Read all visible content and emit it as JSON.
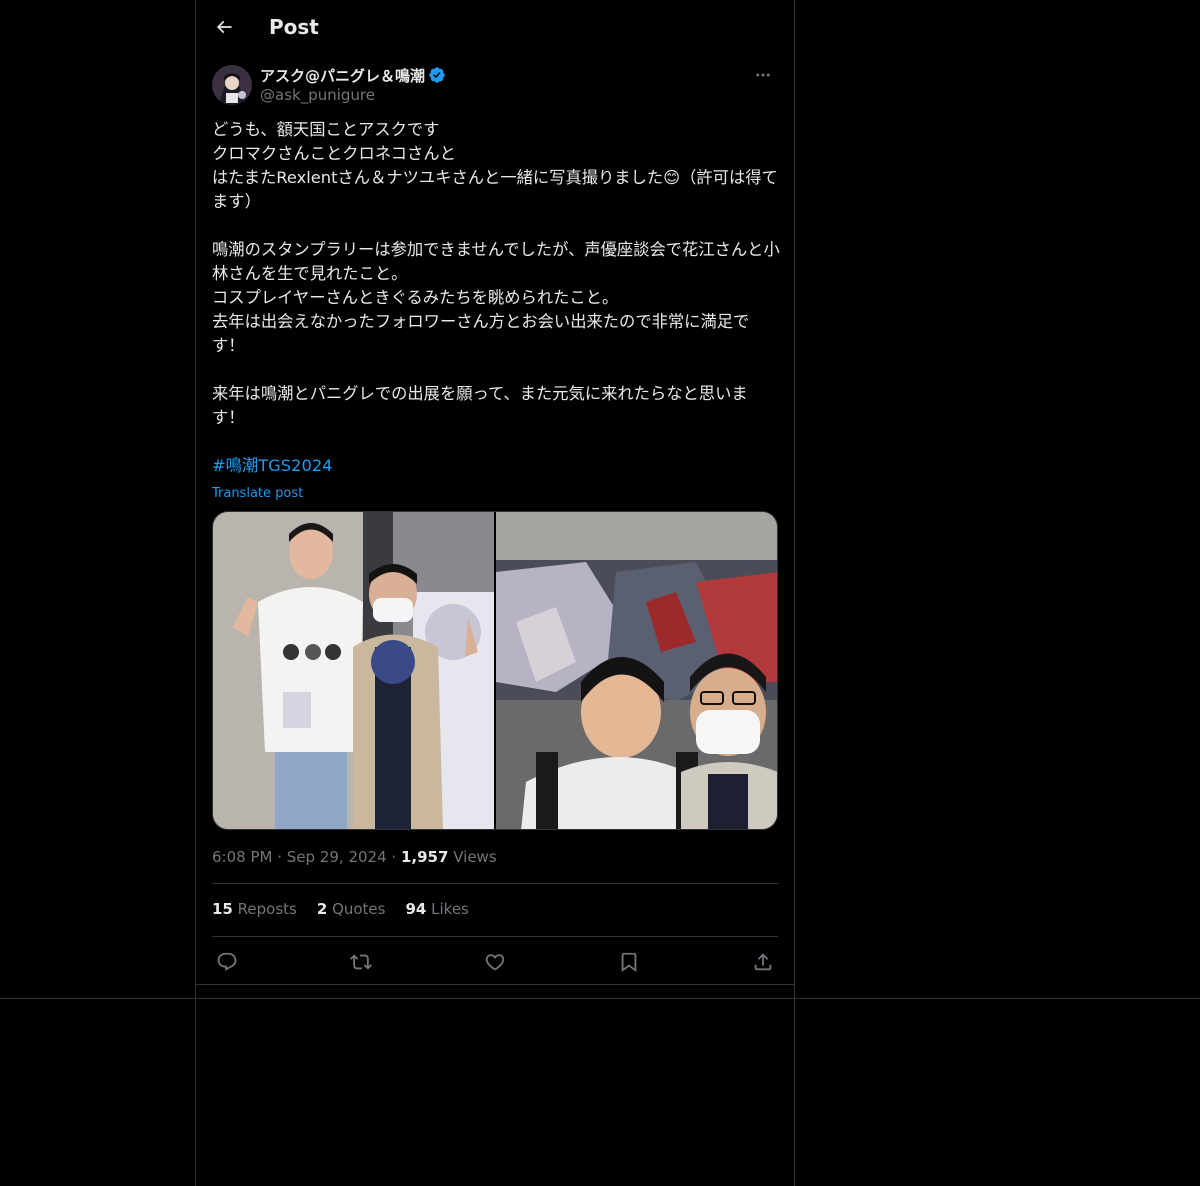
{
  "header": {
    "title": "Post"
  },
  "author": {
    "display_name": "アスク@パニグレ＆鳴潮",
    "handle": "@ask_punigure",
    "verified": true
  },
  "post": {
    "lines_p1": "どうも、額天国ことアスクです\nクロマクさんことクロネコさんと\nはたまたRexlentさん＆ナツユキさんと一緒に写真撮りました😊（許可は得てます）",
    "lines_p2": "鳴潮のスタンプラリーは参加できませんでしたが、声優座談会で花江さんと小林さんを生で見れたこと。\nコスプレイヤーさんときぐるみたちを眺められたこと。\n去年は出会えなかったフォロワーさん方とお会い出来たので非常に満足です！",
    "lines_p3": "来年は鳴潮とパニグレでの出展を願って、また元気に来れたらなと思います！",
    "hashtag": "#鳴潮TGS2024",
    "translate": "Translate post"
  },
  "meta": {
    "time": "6:08 PM",
    "sep1": "·",
    "date": "Sep 29, 2024",
    "sep2": "·",
    "views_count": "1,957",
    "views_label": "Views"
  },
  "stats": {
    "reposts_count": "15",
    "reposts_label": "Reposts",
    "quotes_count": "2",
    "quotes_label": "Quotes",
    "likes_count": "94",
    "likes_label": "Likes"
  },
  "colors": {
    "accent": "#1d9bf0",
    "text": "#e7e9ea",
    "muted": "#71767b",
    "border": "#2f3336",
    "background": "#000000"
  },
  "icons": [
    "back-arrow-icon",
    "verified-badge-icon",
    "more-icon",
    "reply-icon",
    "repost-icon",
    "like-icon",
    "bookmark-icon",
    "share-icon"
  ]
}
